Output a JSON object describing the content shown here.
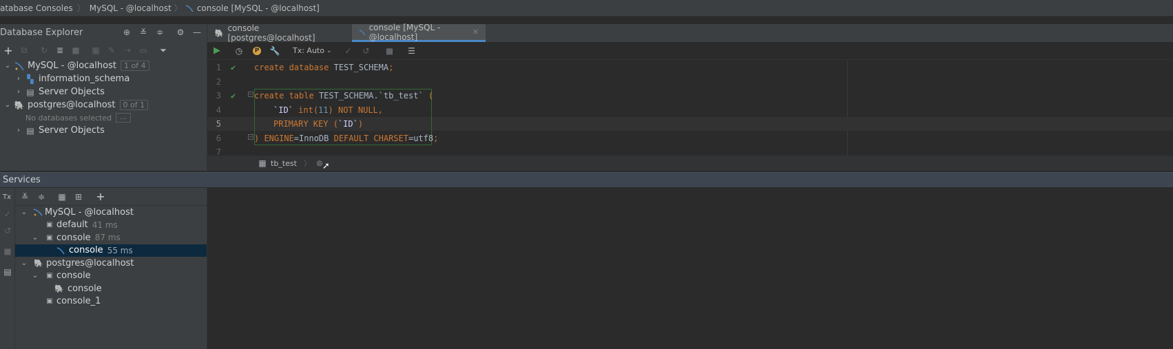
{
  "breadcrumb": {
    "items": [
      "atabase Consoles",
      "MySQL - @localhost",
      "console [MySQL - @localhost]"
    ]
  },
  "explorer": {
    "title": "Database Explorer",
    "tree": {
      "mysql": {
        "label": "MySQL - @localhost",
        "badge": "1 of 4"
      },
      "information_schema": "information_schema",
      "server_objects_1": "Server Objects",
      "postgres": {
        "label": "postgres@localhost",
        "badge": "0 of 1"
      },
      "no_db": "No databases selected",
      "no_db_btn": "...",
      "server_objects_2": "Server Objects"
    }
  },
  "editor": {
    "tabs": [
      {
        "label": "console [postgres@localhost]",
        "active": false
      },
      {
        "label": "console [MySQL - @localhost]",
        "active": true
      }
    ],
    "tx_label": "Tx: Auto",
    "lines": [
      "1",
      "2",
      "3",
      "4",
      "5",
      "6",
      "7"
    ],
    "code": {
      "l1": [
        "create database",
        "TEST_SCHEMA",
        ";"
      ],
      "l3": [
        "create table",
        "TEST_SCHEMA.",
        "`tb_test`",
        " ("
      ],
      "l4": [
        "`ID`",
        "int(",
        "11",
        ")",
        "NOT NULL,"
      ],
      "l5": [
        "PRIMARY KEY (",
        "`ID`",
        ")"
      ],
      "l6": [
        ") ENGINE",
        "=InnoDB",
        "DEFAULT CHARSET",
        "=utf8",
        ";"
      ]
    },
    "status_table": "tb_test"
  },
  "services": {
    "title": "Services",
    "tx_label": "Tx",
    "tree": {
      "mysql": "MySQL - @localhost",
      "default": {
        "label": "default",
        "time": "41 ms"
      },
      "console": {
        "label": "console",
        "time": "87 ms"
      },
      "console_child": {
        "label": "console",
        "time": "55 ms"
      },
      "postgres": "postgres@localhost",
      "pg_console": "console",
      "pg_console_child": "console",
      "pg_console_1": "console_1"
    }
  },
  "colors": {
    "accent": "#4a88c7",
    "selection": "#0d293e",
    "success": "#499c54",
    "keyword": "#cc7832",
    "number": "#6897bb"
  }
}
